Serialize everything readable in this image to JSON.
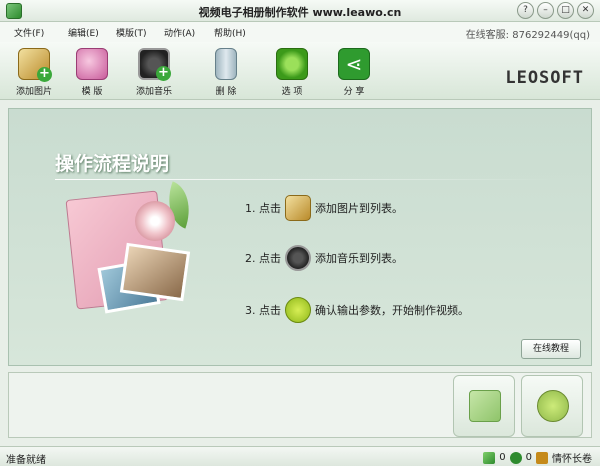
{
  "window": {
    "title": "视频电子相册制作软件 www.leawo.cn",
    "controls": [
      "?",
      "–",
      "□",
      "✕"
    ]
  },
  "menu": {
    "items": [
      "文件(F)",
      "编辑(E)",
      "模版(T)",
      "动作(A)",
      "帮助(H)"
    ],
    "support": "在线客服: 876292449(qq)"
  },
  "toolbar": {
    "add_photo": "添加图片",
    "template": "模 版",
    "add_music": "添加音乐",
    "delete": "删 除",
    "options": "选 项",
    "share": "分 享",
    "brand": "LEOSOFT"
  },
  "main": {
    "heading": "操作流程说明",
    "steps": [
      {
        "prefix": "1. 点击",
        "text": "添加图片到列表。"
      },
      {
        "prefix": "2. 点击",
        "text": "添加音乐到列表。"
      },
      {
        "prefix": "3. 点击",
        "text": "确认输出参数，开始制作视频。"
      }
    ],
    "online_tutorial": "在线教程"
  },
  "status": {
    "text": "准备就绪",
    "image_count": "0",
    "music_count": "0",
    "tip": "情怀长卷"
  },
  "colors": {
    "accent": "#2f9b2f",
    "panel": "#c9dcd0"
  }
}
